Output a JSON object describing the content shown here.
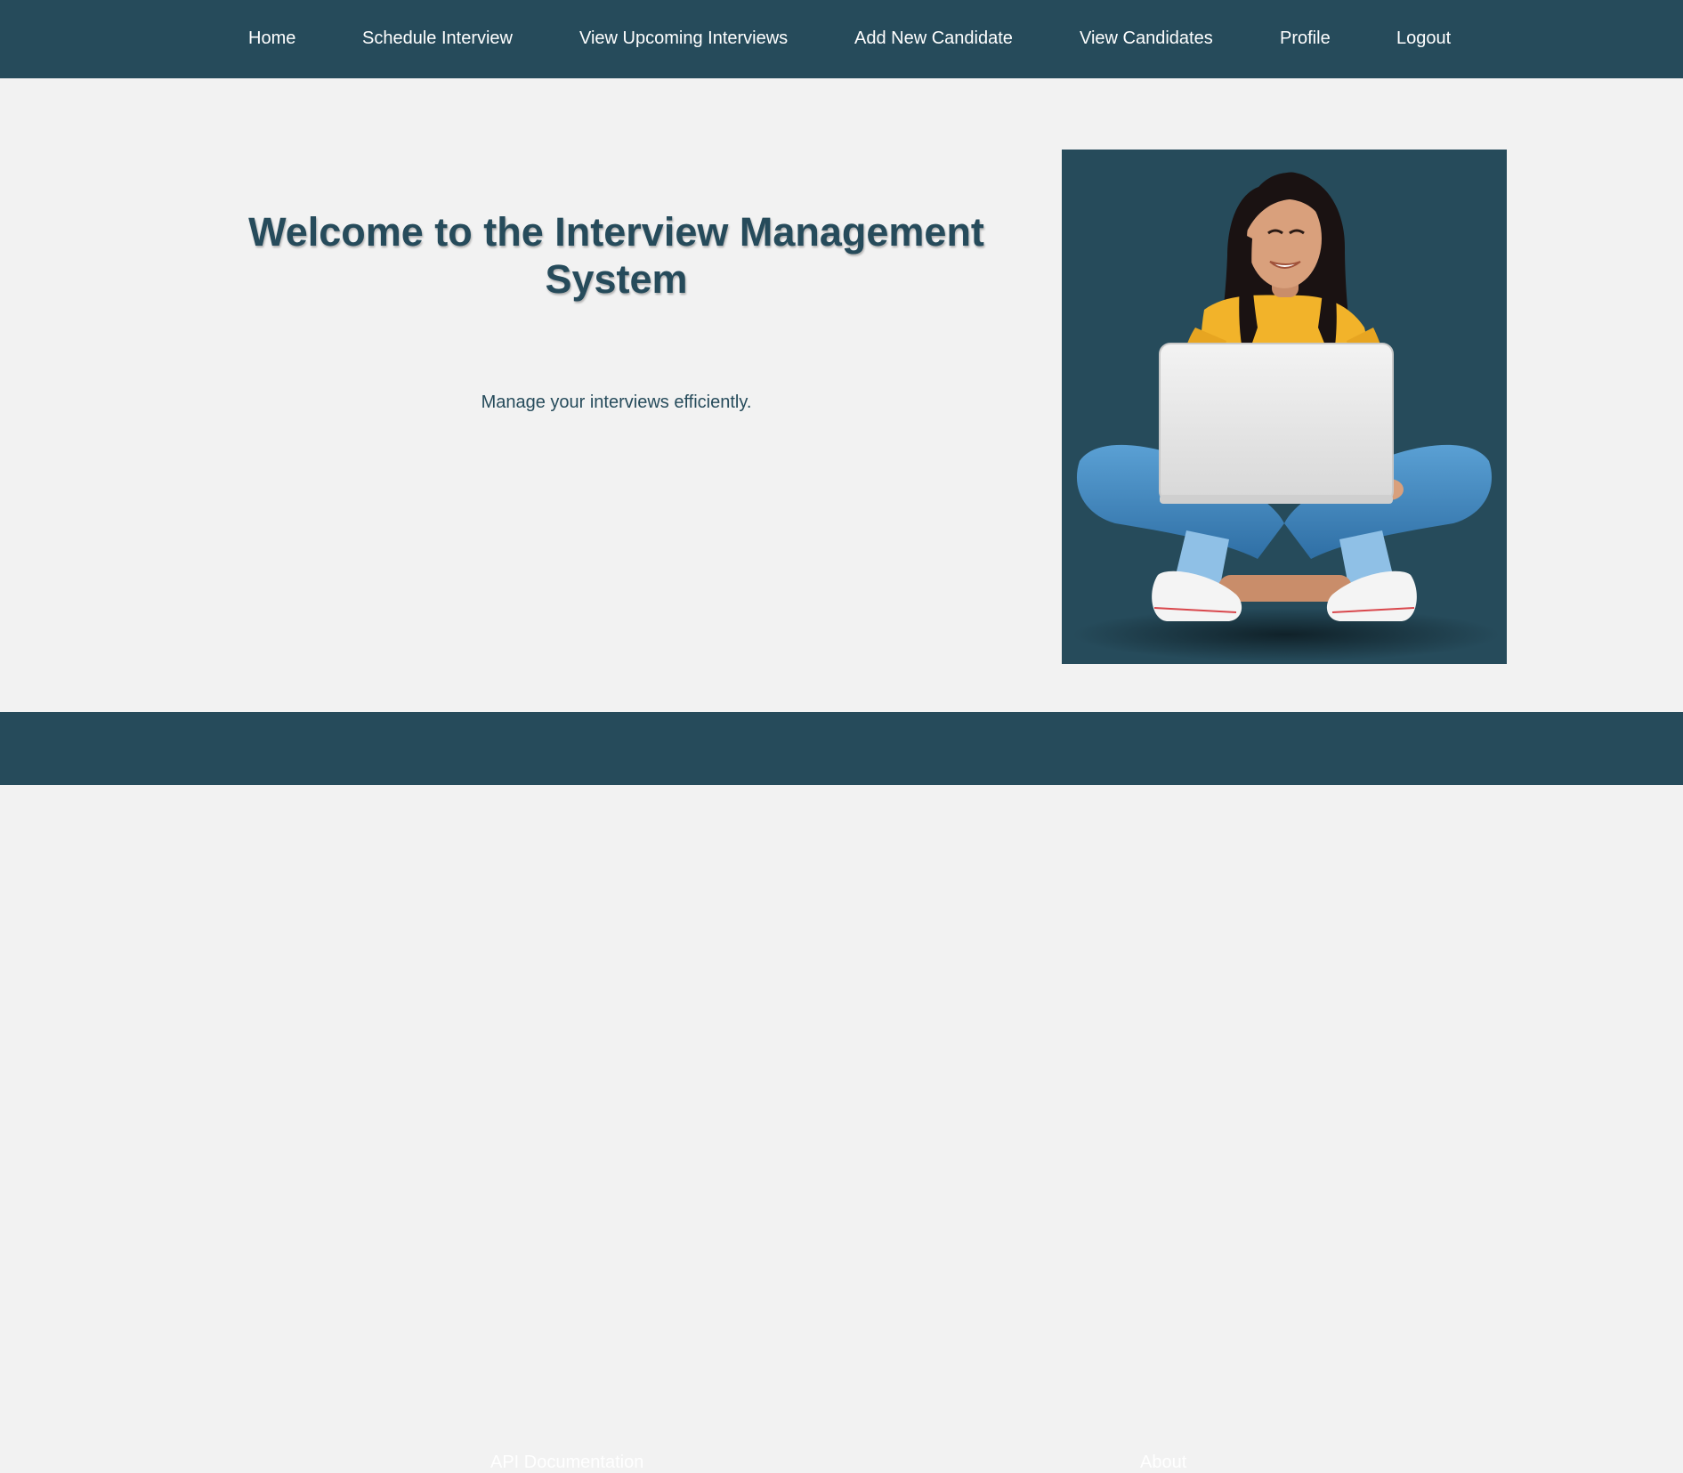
{
  "nav": {
    "items": [
      {
        "label": "Home"
      },
      {
        "label": "Schedule Interview"
      },
      {
        "label": "View Upcoming Interviews"
      },
      {
        "label": "Add New Candidate"
      },
      {
        "label": "View Candidates"
      },
      {
        "label": "Profile"
      },
      {
        "label": "Logout"
      }
    ]
  },
  "hero": {
    "title": "Welcome to the Interview Management System",
    "subtitle": "Manage your interviews efficiently."
  },
  "footer": {
    "links": [
      {
        "label": "API Documentation"
      },
      {
        "label": "About"
      }
    ]
  },
  "colors": {
    "primary": "#264b5b",
    "background": "#f2f2f2",
    "nav_text": "#ffffff",
    "sweater": "#f2b32a",
    "jeans": "#3f86bf",
    "laptop": "#e3e3e3"
  }
}
